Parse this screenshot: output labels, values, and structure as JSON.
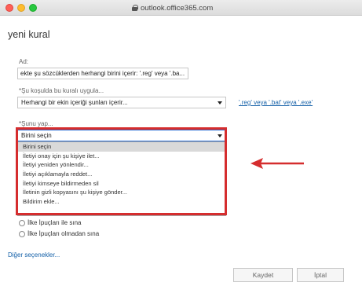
{
  "browser": {
    "url": "outlook.office365.com"
  },
  "page": {
    "title": "yeni kural"
  },
  "name_field": {
    "label": "Ad:",
    "value": "ekte şu sözcüklerden herhangi birini içerir: '.reg' veya '.ba..."
  },
  "condition": {
    "label": "*Şu koşulda bu kuralı uygula...",
    "selected": "Herhangi bir ekin içeriği şunları içerir...",
    "link": "'.reg' veya '.bat' veya '.exe'"
  },
  "action": {
    "label": "*Şunu yap...",
    "selected": "Birini seçin",
    "options": [
      "Birini seçin",
      "İletiyi onay için şu kişiye ilet...",
      "İletiyi yeniden yönlendir...",
      "İletiyi açıklamayla reddet...",
      "İletiyi kimseye bildirmeden sil",
      "İletinin gizli kopyasını şu kişiye gönder...",
      "Bildirim ekle..."
    ]
  },
  "options": {
    "test_with_tips": "İlke İpuçları ile sına",
    "test_without_tips": "İlke İpuçları olmadan sına",
    "more_options": "Diğer seçenekler..."
  },
  "buttons": {
    "save": "Kaydet",
    "cancel": "İptal"
  },
  "colors": {
    "highlight": "#d52d2e",
    "link": "#1460a8",
    "focus": "#2a6fd6"
  },
  "icons": {
    "lock": "lock-icon",
    "caret": "chevron-down-icon",
    "arrow": "arrow-left-icon"
  }
}
